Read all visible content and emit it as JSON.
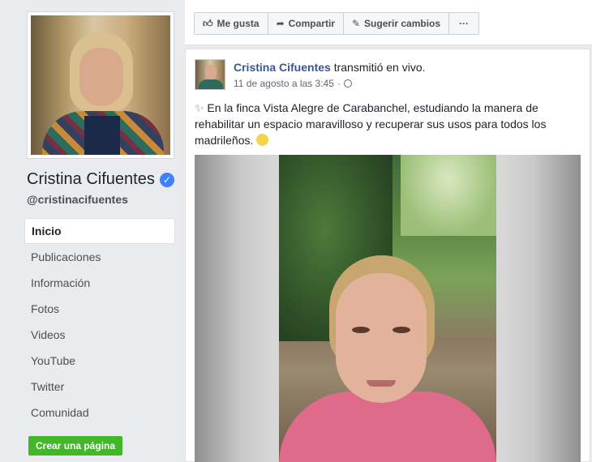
{
  "sidebar": {
    "page_name": "Cristina Cifuentes",
    "handle": "@cristinacifuentes",
    "verified_icon": "verified-check-icon",
    "items": [
      {
        "label": "Inicio",
        "active": true
      },
      {
        "label": "Publicaciones"
      },
      {
        "label": "Información"
      },
      {
        "label": "Fotos"
      },
      {
        "label": "Videos"
      },
      {
        "label": "YouTube"
      },
      {
        "label": "Twitter"
      },
      {
        "label": "Comunidad"
      }
    ],
    "create_page_label": "Crear una página"
  },
  "action_bar": {
    "like_label": "Me gusta",
    "like_icon": "thumbs-up-icon",
    "share_label": "Compartir",
    "share_icon": "share-arrow-icon",
    "suggest_label": "Sugerir cambios",
    "suggest_icon": "pencil-icon",
    "more_label": "···"
  },
  "post": {
    "author": "Cristina Cifuentes",
    "action": "transmitió en vivo.",
    "timestamp": "11 de agosto a las 3:45",
    "privacy_icon": "globe-icon",
    "text": "En la finca Vista Alegre de Carabanchel, estudiando la manera de rehabilitar un espacio maravilloso y recuperar sus usos para todos los madrileños.",
    "emoji": "smiling-face-icon"
  },
  "colors": {
    "accent_blue": "#365899",
    "verified_blue": "#4080ff",
    "create_green": "#42b72a",
    "background": "#e9ebee"
  }
}
